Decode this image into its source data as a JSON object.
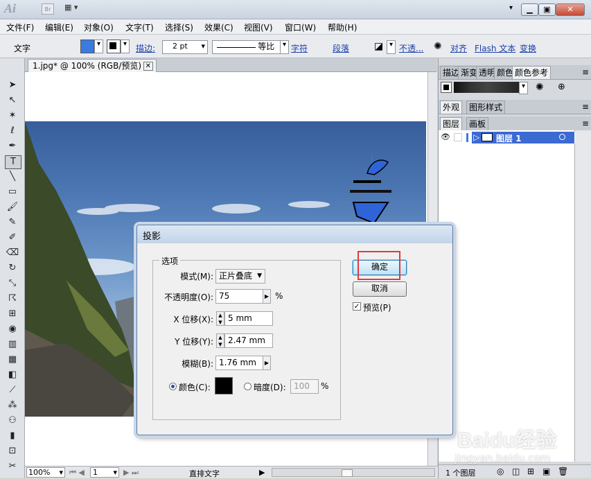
{
  "app": {
    "logo": "Ai",
    "bridge": "Br"
  },
  "menubar": [
    "文件(F)",
    "编辑(E)",
    "对象(O)",
    "文字(T)",
    "选择(S)",
    "效果(C)",
    "视图(V)",
    "窗口(W)",
    "帮助(H)"
  ],
  "control_bar": {
    "tool_label": "文字",
    "stroke_label": "描边:",
    "stroke_weight": "2 pt",
    "stroke_profile": "等比",
    "char_link": "字符",
    "para_link": "段落",
    "opacity_link": "不透...",
    "align_link": "对齐",
    "flash_text": "Flash 文本",
    "transform_link": "变换",
    "colors": {
      "fill": "#3a7be0",
      "stroke": "#000000"
    }
  },
  "document": {
    "tab_title": "1.jpg* @ 100% (RGB/预览)",
    "zoom": "100%",
    "page": "1",
    "status_text": "直排文字"
  },
  "panels": {
    "top_tabs": [
      "描边",
      "渐变",
      "透明",
      "颜色",
      "颜色参考"
    ],
    "appearance_tabs": [
      "外观",
      "图形样式"
    ],
    "layers_tabs": [
      "图层",
      "画板"
    ],
    "layer_name": "图层 1",
    "layer_count": "1 个图层"
  },
  "dialog": {
    "title": "投影",
    "group_title": "选项",
    "mode_label": "模式(M):",
    "mode_value": "正片叠底",
    "opacity_label": "不透明度(O):",
    "opacity_value": "75",
    "opacity_unit": "%",
    "x_label": "X 位移(X):",
    "x_value": "5 mm",
    "y_label": "Y 位移(Y):",
    "y_value": "2.47 mm",
    "blur_label": "模糊(B):",
    "blur_value": "1.76 mm",
    "color_label": "颜色(C):",
    "darkness_label": "暗度(D):",
    "darkness_value": "100",
    "darkness_unit": "%",
    "ok_label": "确定",
    "cancel_label": "取消",
    "preview_label": "预览(P)",
    "shadow_color": "#000000",
    "highlight_color": "#e0393e"
  },
  "watermark": {
    "brand": "Baidu经验",
    "url": "jingyan.baidu.com"
  }
}
